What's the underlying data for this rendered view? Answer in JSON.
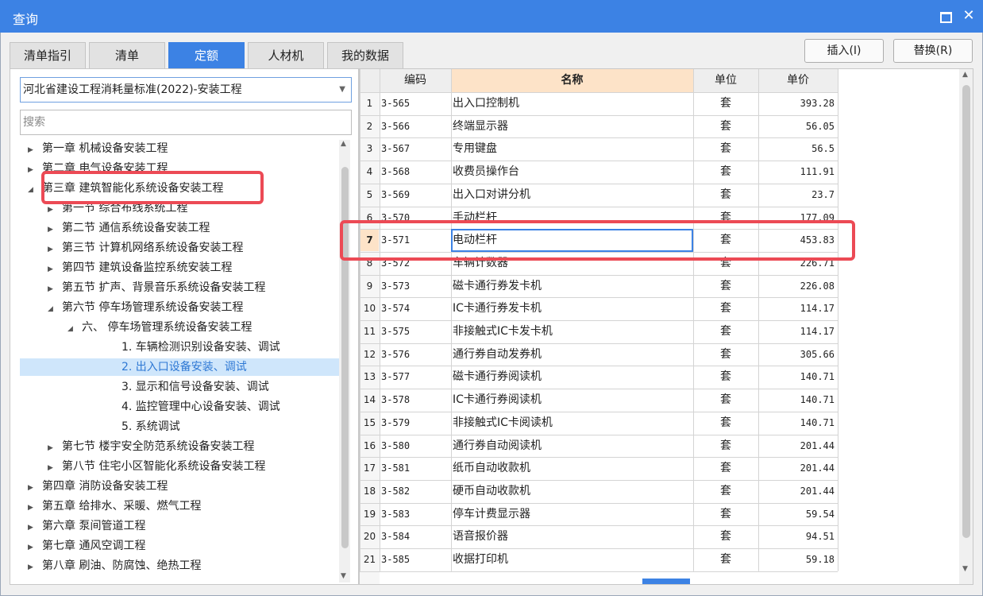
{
  "window": {
    "title": "查询",
    "max_icon": "maximize-icon",
    "close_icon": "close-icon",
    "close_glyph": "✕"
  },
  "tabs": [
    {
      "label": "清单指引",
      "active": false
    },
    {
      "label": "清单",
      "active": false
    },
    {
      "label": "定额",
      "active": true
    },
    {
      "label": "人材机",
      "active": false
    },
    {
      "label": "我的数据",
      "active": false
    }
  ],
  "buttons": {
    "insert": "插入(I)",
    "replace": "替换(R)"
  },
  "library_select": {
    "value": "河北省建设工程消耗量标准(2022)-安装工程"
  },
  "search": {
    "placeholder": "搜索"
  },
  "tree": [
    {
      "label": "第一章 机械设备安装工程",
      "level": 0,
      "toggle": "collapsed"
    },
    {
      "label": "第二章 电气设备安装工程",
      "level": 0,
      "toggle": "collapsed"
    },
    {
      "label": "第三章 建筑智能化系统设备安装工程",
      "level": 0,
      "toggle": "expanded"
    },
    {
      "label": "第一节 综合布线系统工程",
      "level": 1,
      "toggle": "collapsed"
    },
    {
      "label": "第二节 通信系统设备安装工程",
      "level": 1,
      "toggle": "collapsed"
    },
    {
      "label": "第三节 计算机网络系统设备安装工程",
      "level": 1,
      "toggle": "collapsed"
    },
    {
      "label": "第四节 建筑设备监控系统安装工程",
      "level": 1,
      "toggle": "collapsed"
    },
    {
      "label": "第五节 扩声、背景音乐系统设备安装工程",
      "level": 1,
      "toggle": "collapsed"
    },
    {
      "label": "第六节 停车场管理系统设备安装工程",
      "level": 1,
      "toggle": "expanded"
    },
    {
      "label": "六、 停车场管理系统设备安装工程",
      "level": 2,
      "toggle": "expanded"
    },
    {
      "label": "1. 车辆检测识别设备安装、调试",
      "level": 3,
      "toggle": "none"
    },
    {
      "label": "2. 出入口设备安装、调试",
      "level": 3,
      "toggle": "none",
      "selected": true
    },
    {
      "label": "3. 显示和信号设备安装、调试",
      "level": 3,
      "toggle": "none"
    },
    {
      "label": "4. 监控管理中心设备安装、调试",
      "level": 3,
      "toggle": "none"
    },
    {
      "label": "5. 系统调试",
      "level": 3,
      "toggle": "none"
    },
    {
      "label": "第七节 楼宇安全防范系统设备安装工程",
      "level": 1,
      "toggle": "collapsed"
    },
    {
      "label": "第八节 住宅小区智能化系统设备安装工程",
      "level": 1,
      "toggle": "collapsed"
    },
    {
      "label": "第四章 消防设备安装工程",
      "level": 0,
      "toggle": "collapsed"
    },
    {
      "label": "第五章 给排水、采暖、燃气工程",
      "level": 0,
      "toggle": "collapsed"
    },
    {
      "label": "第六章 泵间管道工程",
      "level": 0,
      "toggle": "collapsed"
    },
    {
      "label": "第七章 通风空调工程",
      "level": 0,
      "toggle": "collapsed"
    },
    {
      "label": "第八章 刷油、防腐蚀、绝热工程",
      "level": 0,
      "toggle": "collapsed"
    }
  ],
  "grid": {
    "headers": {
      "code": "编码",
      "name": "名称",
      "unit": "单位",
      "price": "单价"
    },
    "rows": [
      {
        "no": "1",
        "code": "3-565",
        "name": "出入口控制机",
        "unit": "套",
        "price": "393.28"
      },
      {
        "no": "2",
        "code": "3-566",
        "name": "终端显示器",
        "unit": "套",
        "price": "56.05"
      },
      {
        "no": "3",
        "code": "3-567",
        "name": "专用键盘",
        "unit": "套",
        "price": "56.5"
      },
      {
        "no": "4",
        "code": "3-568",
        "name": "收费员操作台",
        "unit": "套",
        "price": "111.91"
      },
      {
        "no": "5",
        "code": "3-569",
        "name": "出入口对讲分机",
        "unit": "套",
        "price": "23.7"
      },
      {
        "no": "6",
        "code": "3-570",
        "name": "手动栏杆",
        "unit": "套",
        "price": "177.09"
      },
      {
        "no": "7",
        "code": "3-571",
        "name": "电动栏杆",
        "unit": "套",
        "price": "453.83",
        "selected": true
      },
      {
        "no": "8",
        "code": "3-572",
        "name": "车辆计数器",
        "unit": "套",
        "price": "226.71"
      },
      {
        "no": "9",
        "code": "3-573",
        "name": "磁卡通行券发卡机",
        "unit": "套",
        "price": "226.08"
      },
      {
        "no": "10",
        "code": "3-574",
        "name": "IC卡通行券发卡机",
        "unit": "套",
        "price": "114.17"
      },
      {
        "no": "11",
        "code": "3-575",
        "name": "非接触式IC卡发卡机",
        "unit": "套",
        "price": "114.17"
      },
      {
        "no": "12",
        "code": "3-576",
        "name": "通行券自动发券机",
        "unit": "套",
        "price": "305.66"
      },
      {
        "no": "13",
        "code": "3-577",
        "name": "磁卡通行券阅读机",
        "unit": "套",
        "price": "140.71"
      },
      {
        "no": "14",
        "code": "3-578",
        "name": "IC卡通行券阅读机",
        "unit": "套",
        "price": "140.71"
      },
      {
        "no": "15",
        "code": "3-579",
        "name": "非接触式IC卡阅读机",
        "unit": "套",
        "price": "140.71"
      },
      {
        "no": "16",
        "code": "3-580",
        "name": "通行券自动阅读机",
        "unit": "套",
        "price": "201.44"
      },
      {
        "no": "17",
        "code": "3-581",
        "name": "纸币自动收款机",
        "unit": "套",
        "price": "201.44"
      },
      {
        "no": "18",
        "code": "3-582",
        "name": "硬币自动收款机",
        "unit": "套",
        "price": "201.44"
      },
      {
        "no": "19",
        "code": "3-583",
        "name": "停车计费显示器",
        "unit": "套",
        "price": "59.54"
      },
      {
        "no": "20",
        "code": "3-584",
        "name": "语音报价器",
        "unit": "套",
        "price": "94.51"
      },
      {
        "no": "21",
        "code": "3-585",
        "name": "收据打印机",
        "unit": "套",
        "price": "59.18"
      }
    ]
  },
  "colors": {
    "accent": "#3c82e4",
    "highlight_box": "#ec4a55",
    "header_name_bg": "#fde3c8",
    "tree_selected_bg": "#cfe6fb"
  }
}
